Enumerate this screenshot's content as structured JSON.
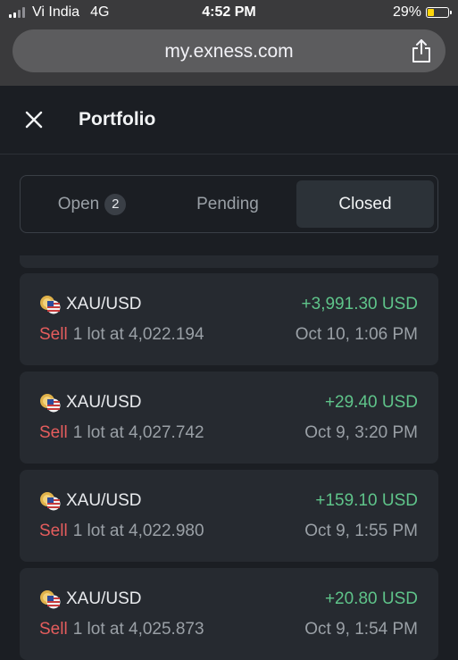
{
  "status_bar": {
    "carrier": "Vi India",
    "network": "4G",
    "time": "4:52 PM",
    "battery": "29%",
    "battery_level": 0.29,
    "battery_color": "#ffd60a"
  },
  "browser": {
    "url": "my.exness.com"
  },
  "header": {
    "title": "Portfolio"
  },
  "tabs": {
    "open_label": "Open",
    "open_count": "2",
    "pending_label": "Pending",
    "closed_label": "Closed",
    "active": "Closed"
  },
  "colors": {
    "profit": "#5fc48a",
    "sell": "#e55d5d",
    "background": "#1b1e23",
    "card": "#262a30"
  },
  "trades": [
    {
      "symbol": "XAU/USD",
      "side": "Sell",
      "detail": "1 lot at 4,022.194",
      "profit": "+3,991.30 USD",
      "date": "Oct 10, 1:06 PM"
    },
    {
      "symbol": "XAU/USD",
      "side": "Sell",
      "detail": "1 lot at 4,027.742",
      "profit": "+29.40 USD",
      "date": "Oct 9, 3:20 PM"
    },
    {
      "symbol": "XAU/USD",
      "side": "Sell",
      "detail": "1 lot at 4,022.980",
      "profit": "+159.10 USD",
      "date": "Oct 9, 1:55 PM"
    },
    {
      "symbol": "XAU/USD",
      "side": "Sell",
      "detail": "1 lot at 4,025.873",
      "profit": "+20.80 USD",
      "date": "Oct 9, 1:54 PM"
    }
  ]
}
